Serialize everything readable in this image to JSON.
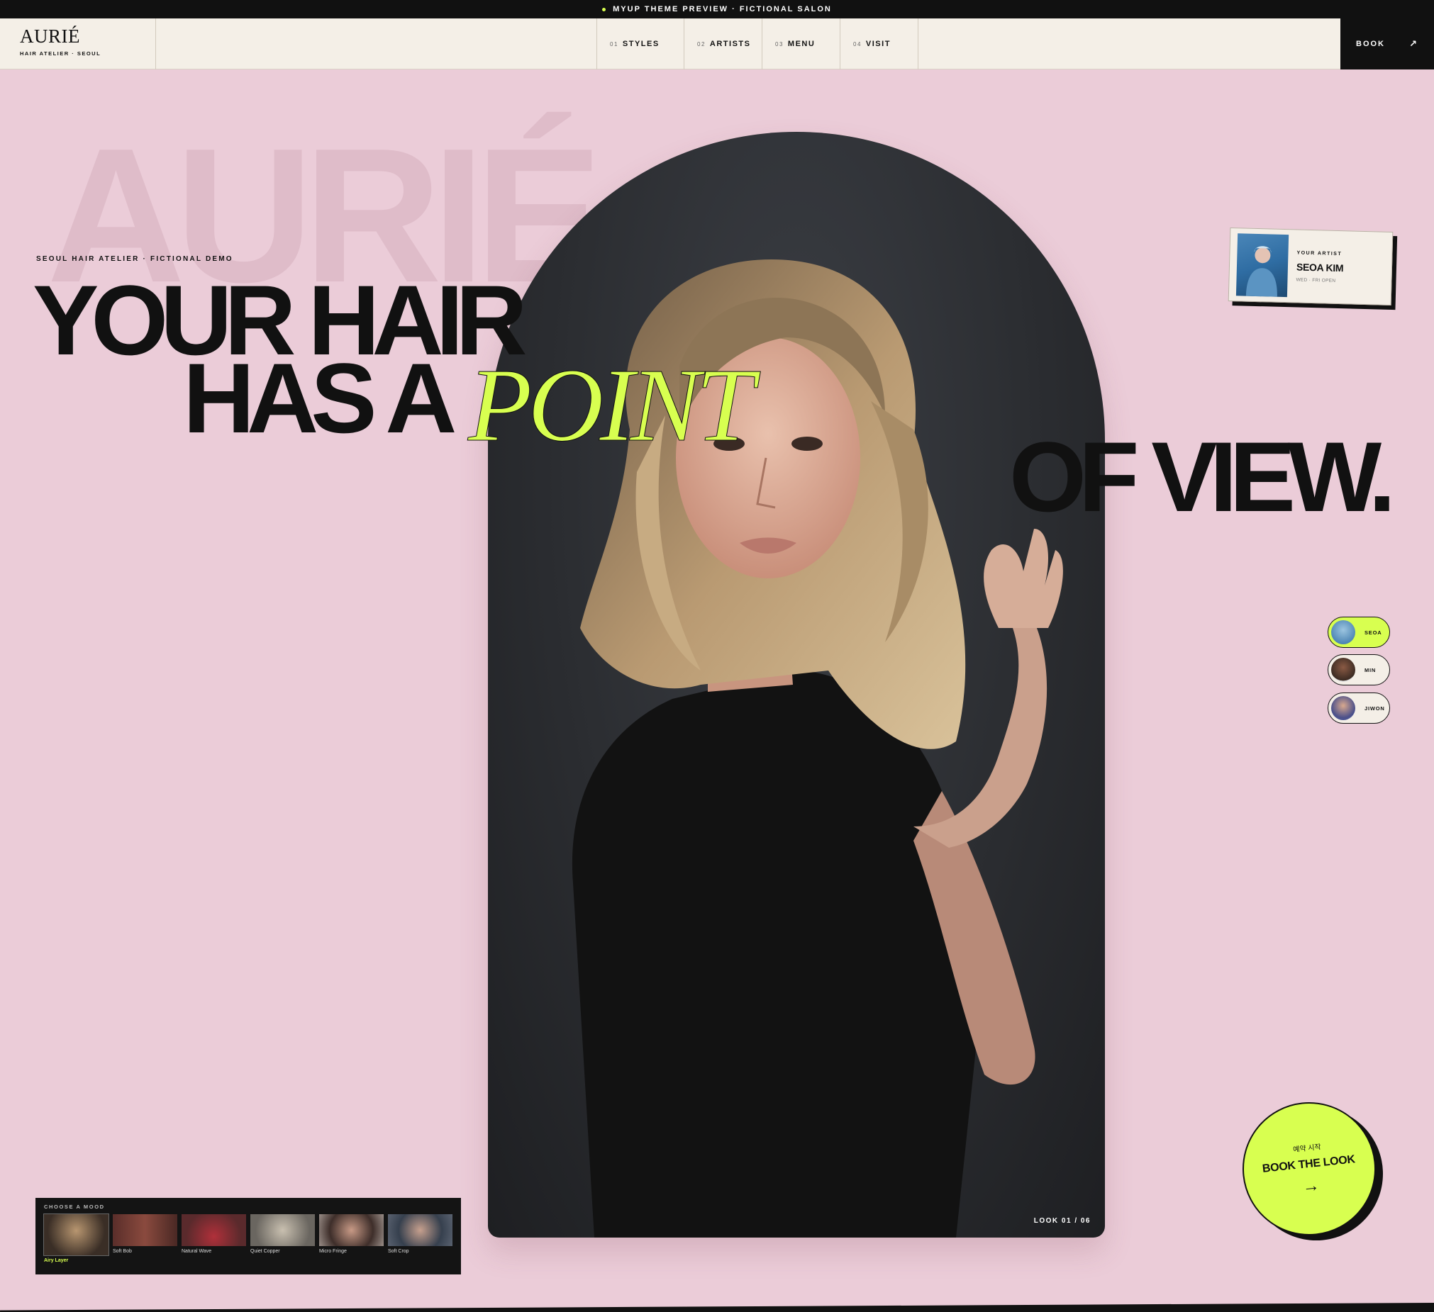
{
  "topbar": {
    "text": "MYUP THEME PREVIEW · FICTIONAL SALON"
  },
  "brand": {
    "name": "AURIÉ",
    "tagline": "HAIR ATELIER · SEOUL"
  },
  "nav": [
    {
      "num": "01",
      "label": "STYLES"
    },
    {
      "num": "02",
      "label": "ARTISTS"
    },
    {
      "num": "03",
      "label": "MENU"
    },
    {
      "num": "04",
      "label": "VISIT"
    }
  ],
  "book_button": {
    "label": "BOOK",
    "icon": "arrow-up-right-icon"
  },
  "hero": {
    "background_word": "AURIÉ",
    "eyebrow": "SEOUL HAIR ATELIER · FICTIONAL DEMO",
    "line1": "YOUR HAIR",
    "line2": "HAS A",
    "accent_word": "POINT",
    "line3": "OF VIEW.",
    "look_counter": "LOOK 01 / 06"
  },
  "artist_card": {
    "eyebrow": "YOUR ARTIST",
    "name": "SEOA KIM",
    "days": "WED · FRI OPEN"
  },
  "artist_chips": [
    {
      "label": "SEOA",
      "active": true
    },
    {
      "label": "MIN",
      "active": false
    },
    {
      "label": "JIWON",
      "active": false
    }
  ],
  "mood": {
    "title": "CHOOSE A MOOD",
    "items": [
      {
        "label": "Airy Layer",
        "active": true
      },
      {
        "label": "Soft Bob",
        "active": false
      },
      {
        "label": "Natural Wave",
        "active": false
      },
      {
        "label": "Quiet Copper",
        "active": false
      },
      {
        "label": "Micro Fringe",
        "active": false
      },
      {
        "label": "Soft Crop",
        "active": false
      }
    ]
  },
  "book_the_look": {
    "korean": "예약 시작",
    "label": "BOOK THE LOOK",
    "icon": "arrow-right-icon"
  },
  "colors": {
    "accent": "#d8ff50",
    "background": "#ebccd8",
    "ink": "#111111",
    "cream": "#f4efe7"
  }
}
